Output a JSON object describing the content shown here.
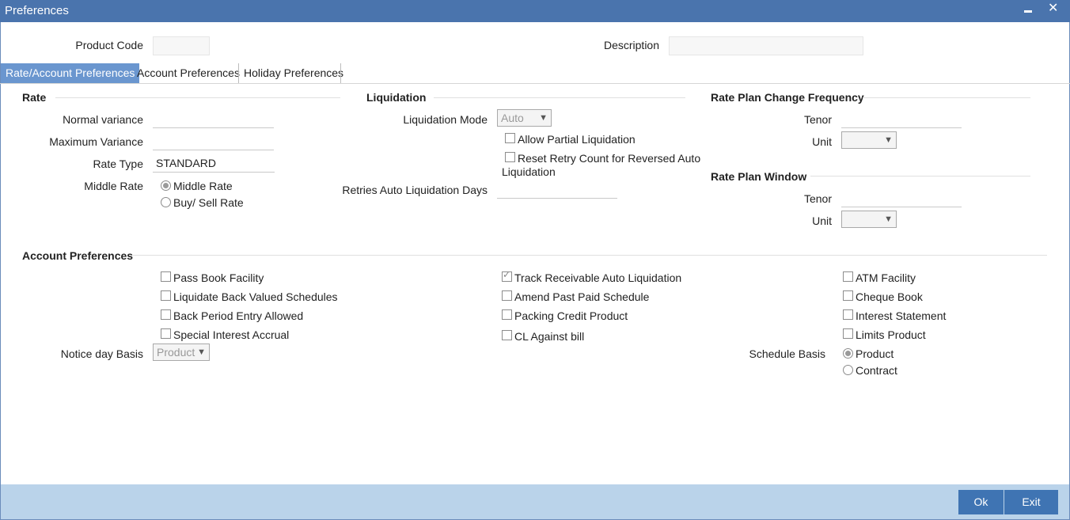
{
  "window": {
    "title": "Preferences",
    "minimize": "▬",
    "close": "✕"
  },
  "header": {
    "product_code_label": "Product Code",
    "product_code_value": "",
    "description_label": "Description",
    "description_value": ""
  },
  "tabs": [
    {
      "label": "Rate/Account Preferences",
      "active": true
    },
    {
      "label": "Account Preferences",
      "active": false
    },
    {
      "label": "Holiday Preferences",
      "active": false
    }
  ],
  "rate": {
    "title": "Rate",
    "normal_variance_label": "Normal variance",
    "normal_variance_value": "",
    "maximum_variance_label": "Maximum Variance",
    "maximum_variance_value": "",
    "rate_type_label": "Rate Type",
    "rate_type_value": "STANDARD",
    "middle_rate_label": "Middle Rate",
    "options": [
      {
        "label": "Middle Rate",
        "selected": true
      },
      {
        "label": "Buy/ Sell Rate",
        "selected": false
      }
    ]
  },
  "liquidation": {
    "title": "Liquidation",
    "mode_label": "Liquidation Mode",
    "mode_value": "Auto",
    "allow_partial_label": "Allow Partial Liquidation",
    "reset_retry_label_line1": "Reset Retry Count for Reversed Auto",
    "reset_retry_label_line2": "Liquidation",
    "retries_label": "Retries Auto Liquidation Days",
    "retries_value": ""
  },
  "rate_plan_change": {
    "title": "Rate Plan Change Frequency",
    "tenor_label": "Tenor",
    "tenor_value": "",
    "unit_label": "Unit",
    "unit_value": ""
  },
  "rate_plan_window": {
    "title": "Rate Plan Window",
    "tenor_label": "Tenor",
    "tenor_value": "",
    "unit_label": "Unit",
    "unit_value": ""
  },
  "account_preferences": {
    "title": "Account Preferences",
    "col1": [
      {
        "label": "Pass Book Facility",
        "checked": false
      },
      {
        "label": "Liquidate Back Valued Schedules",
        "checked": false
      },
      {
        "label": "Back Period Entry Allowed",
        "checked": false
      },
      {
        "label": "Special Interest Accrual",
        "checked": false
      }
    ],
    "col2": [
      {
        "label": "Track Receivable Auto Liquidation",
        "checked": true
      },
      {
        "label": "Amend Past Paid Schedule",
        "checked": false
      },
      {
        "label": "Packing Credit Product",
        "checked": false
      },
      {
        "label": "CL Against bill",
        "checked": false
      }
    ],
    "col3": [
      {
        "label": "ATM Facility",
        "checked": false
      },
      {
        "label": "Cheque Book",
        "checked": false
      },
      {
        "label": "Interest Statement",
        "checked": false
      },
      {
        "label": "Limits Product",
        "checked": false
      }
    ],
    "notice_day_basis_label": "Notice day Basis",
    "notice_day_basis_value": "Product",
    "schedule_basis_label": "Schedule Basis",
    "schedule_basis_options": [
      {
        "label": "Product",
        "selected": true
      },
      {
        "label": "Contract",
        "selected": false
      }
    ]
  },
  "footer": {
    "ok_label": "Ok",
    "exit_label": "Exit"
  }
}
